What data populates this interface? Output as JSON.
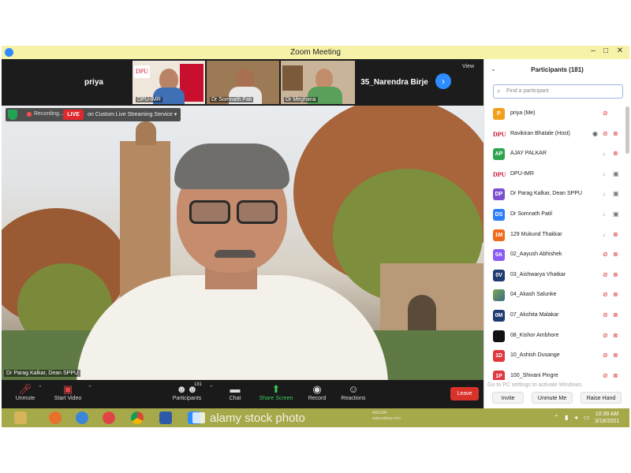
{
  "window": {
    "title": "Zoom Meeting",
    "minimize": "–",
    "maximize": "□",
    "close": "✕"
  },
  "strip": {
    "tiles": [
      {
        "name": "priya"
      },
      {
        "name": "DPU-IMR"
      },
      {
        "name": "Dr Somnath Pati"
      },
      {
        "name": "Dr Meghana"
      },
      {
        "name": "35_Narendra Birje"
      }
    ],
    "view_label": "View",
    "next_icon": "chevron-right-icon"
  },
  "recording": {
    "label": "Recording...",
    "live_badge": "LIVE",
    "live_text": "on Custom Live Streaming Service",
    "caret": "▾"
  },
  "main_video": {
    "speaker_name": "Dr Parag Kalkar, Dean SPPU"
  },
  "toolbar": {
    "unmute": "Unmute",
    "start_video": "Start Video",
    "participants": "Participants",
    "participants_count": "181",
    "chat": "Chat",
    "share_screen": "Share Screen",
    "record": "Record",
    "reactions": "Reactions",
    "leave": "Leave"
  },
  "participants_panel": {
    "title": "Participants (181)",
    "search_placeholder": "Find a participant",
    "rows": [
      {
        "initials": "P",
        "color": "#f29f1c",
        "name": "priya (Me)",
        "mic": "muted",
        "cam": "none"
      },
      {
        "initials": "DPU",
        "color": "dpu",
        "name": "Ravikiran Bhatale (Host)",
        "mic": "muted",
        "cam": "off",
        "host": true
      },
      {
        "initials": "AP",
        "color": "#2ea44f",
        "name": "AJAY PALKAR",
        "mic": "on",
        "cam": "off"
      },
      {
        "initials": "DPU",
        "color": "dpu",
        "name": "DPU-IMR",
        "mic": "on",
        "cam": "on"
      },
      {
        "initials": "DP",
        "color": "#7b4fd1",
        "name": "Dr Parag Kalkar, Dean SPPU",
        "mic": "on",
        "cam": "on"
      },
      {
        "initials": "DS",
        "color": "#2d7ff9",
        "name": "Dr Somnath Patil",
        "mic": "on",
        "cam": "on"
      },
      {
        "initials": "1M",
        "color": "#f06a1c",
        "name": "129 Mukund Thakkar",
        "mic": "on",
        "cam": "off"
      },
      {
        "initials": "0A",
        "color": "#8b5cf6",
        "name": "02_Aayush Abhishek",
        "mic": "muted",
        "cam": "off"
      },
      {
        "initials": "0V",
        "color": "#1f3b6f",
        "name": "03_Aishwarya Vhatkar",
        "mic": "muted",
        "cam": "off"
      },
      {
        "initials": "",
        "color": "photo",
        "name": "04_Akash Salunke",
        "mic": "muted",
        "cam": "off"
      },
      {
        "initials": "0M",
        "color": "#1f3b6f",
        "name": "07_Akshita Malakar",
        "mic": "muted",
        "cam": "off"
      },
      {
        "initials": "",
        "color": "#111111",
        "name": "08_Kishor Ambhore",
        "mic": "muted",
        "cam": "off"
      },
      {
        "initials": "1D",
        "color": "#e0383e",
        "name": "10_Ashish Dusange",
        "mic": "muted",
        "cam": "off"
      },
      {
        "initials": "1P",
        "color": "#e0383e",
        "name": "100_Shivani Pingre",
        "mic": "muted",
        "cam": "off"
      }
    ],
    "invite": "Invite",
    "unmute_me": "Unmute Me",
    "raise_hand": "Raise Hand"
  },
  "activation_notice": "Go to PC settings to activate Windows.",
  "taskbar": {
    "watermark": "alamy stock photo",
    "watermark_small": "A5NJ9R\nwww.alamy.com",
    "time": "10:39 AM",
    "date": "3/18/2021"
  },
  "colors": {
    "zoom_blue": "#2d8cff",
    "live_red": "#e0282e",
    "leave_red": "#d9322a",
    "share_green": "#3cc95c",
    "taskbar": "#a6a94a"
  }
}
